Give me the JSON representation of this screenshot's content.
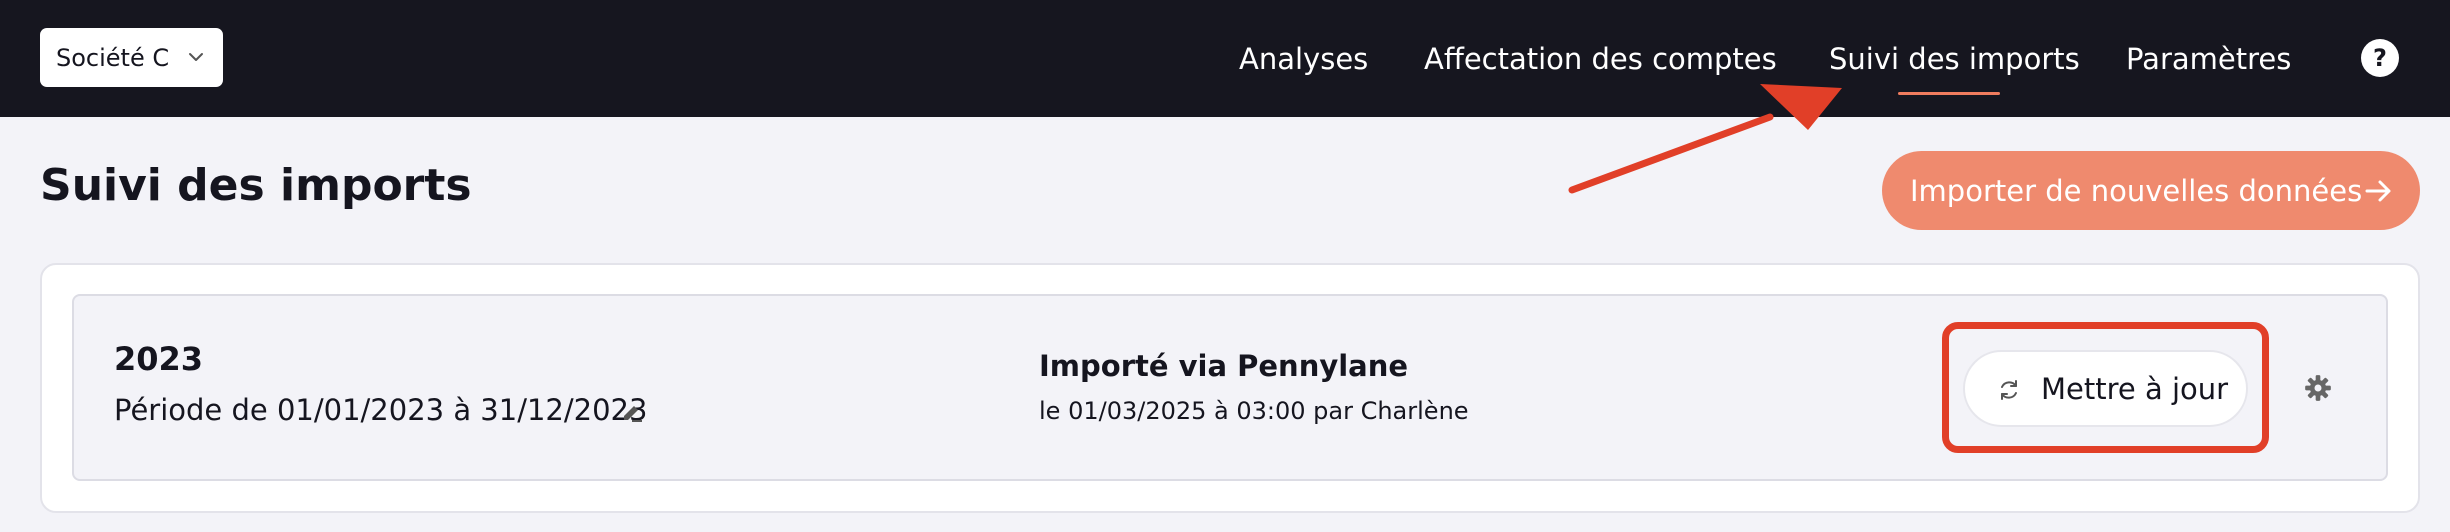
{
  "header": {
    "company_select": {
      "value": "Société C",
      "icon": "chevron-down-icon"
    },
    "nav": [
      {
        "label": "Analyses",
        "active": false
      },
      {
        "label": "Affectation des comptes",
        "active": false
      },
      {
        "label": "Suivi des imports",
        "active": true
      },
      {
        "label": "Paramètres",
        "active": false
      }
    ],
    "help_icon": "?"
  },
  "page": {
    "title": "Suivi des imports",
    "import_button": {
      "label": "Importer de nouvelles données",
      "icon": "arrow-right-icon"
    }
  },
  "imports": [
    {
      "year": "2023",
      "period": "Période de 01/01/2023 à 31/12/2023",
      "source": "Importé via Pennylane",
      "imported_at": "le 01/03/2025 à 03:00 par Charlène",
      "update_button": {
        "label": "Mettre à jour",
        "icon": "refresh-icon"
      },
      "settings_icon": "gear-icon",
      "edit_icon": "pencil-icon"
    }
  ],
  "annotations": {
    "arrow": "red-arrow-pointing-to-active-tab",
    "highlight": "red-box-around-update-button"
  },
  "colors": {
    "topbar": "#16161f",
    "accent": "#ef8a6e",
    "accent_underline": "#ef7c5e",
    "background": "#f3f3f8",
    "annotation": "#e13f28"
  }
}
